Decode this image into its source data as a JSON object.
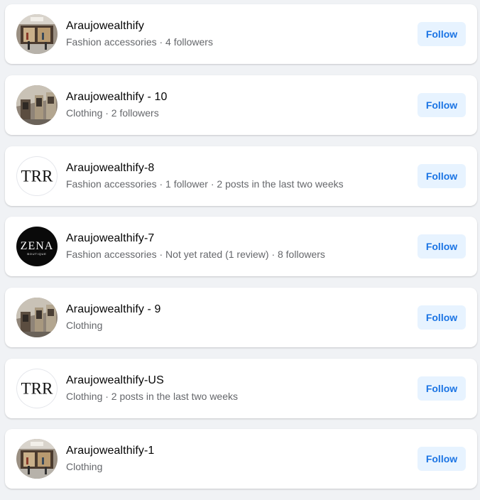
{
  "pages": [
    {
      "name": "Araujowealthify",
      "meta": "Fashion accessories · 4 followers",
      "avatar": "storefront-photo-icon",
      "follow_label": "Follow"
    },
    {
      "name": "Araujowealthify - 10",
      "meta": "Clothing · 2 followers",
      "avatar": "building-photo-icon",
      "follow_label": "Follow"
    },
    {
      "name": "Araujowealthify-8",
      "meta": "Fashion accessories · 1 follower · 2 posts in the last two weeks",
      "avatar": "trr-logo-icon",
      "follow_label": "Follow"
    },
    {
      "name": "Araujowealthify-7",
      "meta": "Fashion accessories · Not yet rated (1 review) · 8 followers",
      "avatar": "zena-boutique-logo-icon",
      "follow_label": "Follow"
    },
    {
      "name": "Araujowealthify - 9",
      "meta": "Clothing",
      "avatar": "building-photo-icon",
      "follow_label": "Follow"
    },
    {
      "name": "Araujowealthify-US",
      "meta": "Clothing · 2 posts in the last two weeks",
      "avatar": "trr-logo-icon",
      "follow_label": "Follow"
    },
    {
      "name": "Araujowealthify-1",
      "meta": "Clothing",
      "avatar": "storefront-photo-icon",
      "follow_label": "Follow"
    }
  ],
  "logos": {
    "trr_text": "TRR",
    "zena_text": "ZENA",
    "zena_sub": "BOUTIQUE"
  },
  "colors": {
    "background": "#f0f2f5",
    "card": "#ffffff",
    "follow_bg": "#e7f3ff",
    "follow_text": "#1b74e4",
    "meta_text": "#65676b"
  }
}
